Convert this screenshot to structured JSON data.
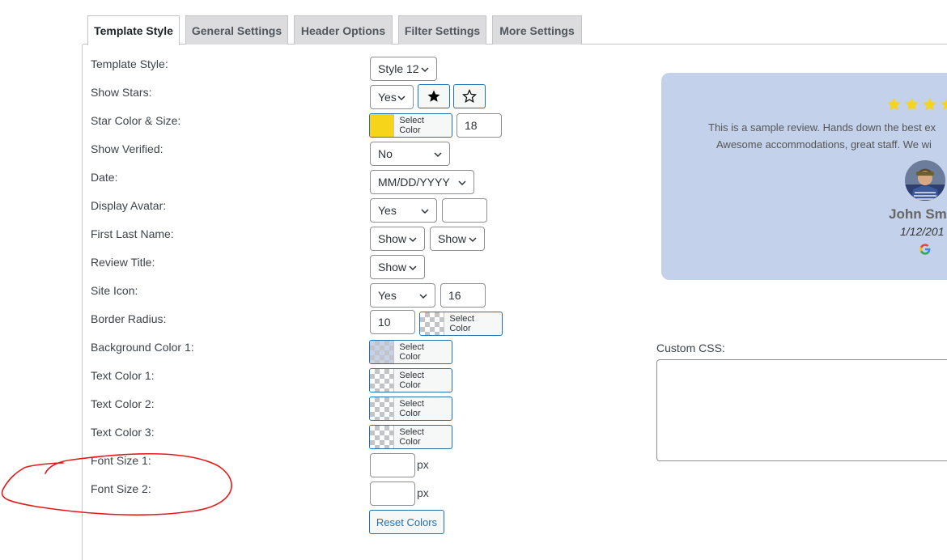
{
  "tabs": [
    "Template Style",
    "General Settings",
    "Header Options",
    "Filter Settings",
    "More Settings"
  ],
  "labels": {
    "template_style": "Template Style:",
    "show_stars": "Show Stars:",
    "star_color_size": "Star Color & Size:",
    "show_verified": "Show Verified:",
    "date": "Date:",
    "display_avatar": "Display Avatar:",
    "first_last_name": "First Last Name:",
    "review_title": "Review Title:",
    "site_icon": "Site Icon:",
    "border_radius": "Border Radius:",
    "bg_color_1": "Background Color 1:",
    "text_color_1": "Text Color 1:",
    "text_color_2": "Text Color 2:",
    "text_color_3": "Text Color 3:",
    "font_size_1": "Font Size 1:",
    "font_size_2": "Font Size 2:"
  },
  "values": {
    "template_style": "Style 12",
    "show_stars": "Yes",
    "star_size": "18",
    "show_verified": "No",
    "date_format": "MM/DD/YYYY",
    "display_avatar": "Yes",
    "avatar_size": "",
    "first_name": "Show",
    "last_name": "Show",
    "review_title": "Show",
    "site_icon": "Yes",
    "site_icon_size": "16",
    "border_radius": "10",
    "font_size_1": "",
    "font_size_2": ""
  },
  "select_color_label": "Select Color",
  "px_unit": "px",
  "reset_colors_label": "Reset Colors",
  "colors": {
    "star": "#f5d419",
    "preview_bg": "#c3d1eb",
    "annotation": "#e21a1a"
  },
  "preview": {
    "review_text_line1": "This is a sample review. Hands down the best ex",
    "review_text_line2": "Awesome accommodations, great staff. We wi",
    "name": "John Smi",
    "date": "1/12/201"
  },
  "custom_css": {
    "label": "Custom CSS:",
    "value": ""
  }
}
